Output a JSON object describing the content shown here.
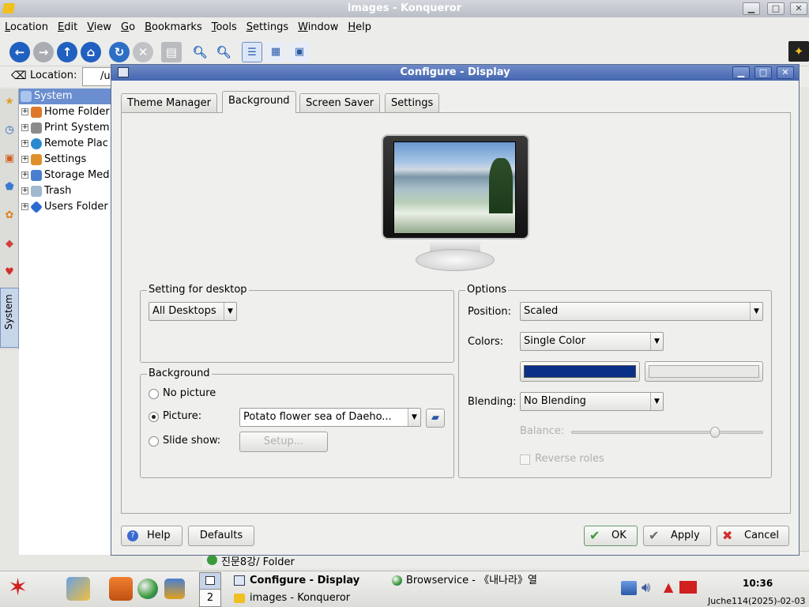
{
  "konqueror": {
    "title": "images - Konqueror",
    "menus": [
      "Location",
      "Edit",
      "View",
      "Go",
      "Bookmarks",
      "Tools",
      "Settings",
      "Window",
      "Help"
    ],
    "location_label": "Location:",
    "location_value": "/u",
    "sidebar_vertical_tab": "System",
    "tree": [
      {
        "label": "System",
        "selected": true,
        "icon_color": "#4a7fd0"
      },
      {
        "label": "Home Folder",
        "icon_color": "#e0782a"
      },
      {
        "label": "Print System",
        "icon_color": "#777"
      },
      {
        "label": "Remote Plac",
        "icon_color": "#2a8ad0"
      },
      {
        "label": "Settings",
        "icon_color": "#e0902a"
      },
      {
        "label": "Storage Med",
        "icon_color": "#4a7fd0"
      },
      {
        "label": "Trash",
        "icon_color": "#a0b8d0"
      },
      {
        "label": "Users Folder",
        "icon_color": "#2a6ad0"
      }
    ],
    "status_text": "진문8강/  Folder"
  },
  "dialog": {
    "title": "Configure - Display",
    "tabs": [
      "Theme Manager",
      "Background",
      "Screen Saver",
      "Settings"
    ],
    "active_tab": "Background",
    "setting_for_desktop": {
      "label": "Setting for desktop",
      "value": "All Desktops"
    },
    "background": {
      "label": "Background",
      "no_picture": "No picture",
      "picture": "Picture:",
      "picture_value": "Potato flower sea of Daeho...",
      "slide_show": "Slide show:",
      "setup": "Setup..."
    },
    "options": {
      "label": "Options",
      "position_label": "Position:",
      "position_value": "Scaled",
      "colors_label": "Colors:",
      "colors_value": "Single Color",
      "color1": "#0a2f86",
      "color2": "#e8e8e6",
      "blending_label": "Blending:",
      "blending_value": "No Blending",
      "balance_label": "Balance:",
      "balance_level": 0.75,
      "reverse_roles": "Reverse roles"
    },
    "buttons": {
      "help": "Help",
      "defaults": "Defaults",
      "ok": "OK",
      "apply": "Apply",
      "cancel": "Cancel"
    }
  },
  "taskbar": {
    "desktop_number": "2",
    "tasks": [
      {
        "label": "Configure - Display",
        "bold": true
      },
      {
        "label": "images - Konqueror",
        "bold": false
      },
      {
        "label": "Browservice - 《내나라》열",
        "bold": false
      }
    ],
    "clock_time": "10:36",
    "clock_date": "Juche114(2025)-02-03"
  }
}
